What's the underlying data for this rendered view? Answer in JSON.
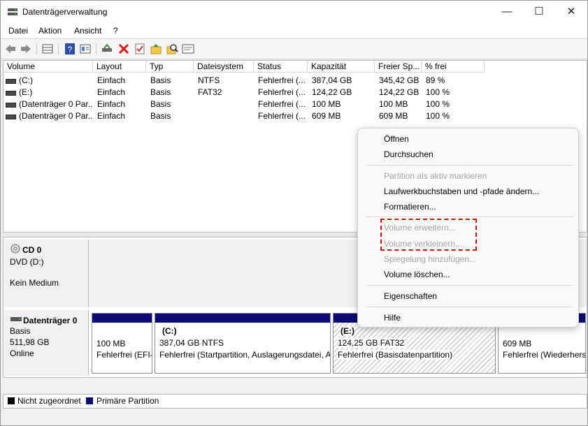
{
  "window": {
    "title": "Datenträgerverwaltung",
    "min": "—",
    "max": "☐",
    "close": "✕"
  },
  "menu": [
    "Datei",
    "Aktion",
    "Ansicht",
    "?"
  ],
  "toolbar_icons": [
    "back-icon",
    "forward-icon",
    "list-view-icon",
    "help-icon",
    "properties-icon",
    "connect-icon",
    "delete-icon",
    "check-icon",
    "folder-up-icon",
    "search-icon",
    "console-icon"
  ],
  "volume_table": {
    "columns": [
      "Volume",
      "Layout",
      "Typ",
      "Dateisystem",
      "Status",
      "Kapazität",
      "Freier Sp...",
      "% frei"
    ],
    "rows": [
      [
        "(C:)",
        "Einfach",
        "Basis",
        "NTFS",
        "Fehlerfrei (...",
        "387,04 GB",
        "345,42 GB",
        "89 %"
      ],
      [
        "(E:)",
        "Einfach",
        "Basis",
        "FAT32",
        "Fehlerfrei (...",
        "124,22 GB",
        "124,22 GB",
        "100 %"
      ],
      [
        "(Datenträger 0 Par...",
        "Einfach",
        "Basis",
        "",
        "Fehlerfrei (...",
        "100 MB",
        "100 MB",
        "100 %"
      ],
      [
        "(Datenträger 0 Par...",
        "Einfach",
        "Basis",
        "",
        "Fehlerfrei (...",
        "609 MB",
        "609 MB",
        "100 %"
      ]
    ]
  },
  "cd": {
    "name": "CD 0",
    "drive": "DVD (D:)",
    "media": "Kein Medium"
  },
  "disk0": {
    "name": "Datenträger 0",
    "type": "Basis",
    "size": "511,98 GB",
    "state": "Online",
    "partitions": [
      {
        "label": "",
        "size": "100 MB",
        "status": "Fehlerfrei (EFI-"
      },
      {
        "label": "(C:)",
        "size": "387,04 GB NTFS",
        "status": "Fehlerfrei (Startpartition, Auslagerungsdatei, A"
      },
      {
        "label": "(E:)",
        "size": "124,25 GB FAT32",
        "status": "Fehlerfrei (Basisdatenpartition)"
      },
      {
        "label": "",
        "size": "609 MB",
        "status": "Fehlerfrei (Wiederhers"
      }
    ]
  },
  "legend": [
    {
      "label": "Nicht zugeordnet",
      "color": "#000000"
    },
    {
      "label": "Primäre Partition",
      "color": "#0a0a78"
    }
  ],
  "context_menu": {
    "items": [
      {
        "label": "Öffnen",
        "enabled": true
      },
      {
        "label": "Durchsuchen",
        "enabled": true
      },
      {
        "label": "Partition als aktiv markieren",
        "enabled": false
      },
      {
        "label": "Laufwerkbuchstaben und -pfade ändern...",
        "enabled": true
      },
      {
        "label": "Formatieren...",
        "enabled": true
      },
      {
        "label": "Volume erweitern...",
        "enabled": false
      },
      {
        "label": "Volume verkleinern...",
        "enabled": false
      },
      {
        "label": "Spiegelung hinzufügen...",
        "enabled": false
      },
      {
        "label": "Volume löschen...",
        "enabled": true
      },
      {
        "label": "Eigenschaften",
        "enabled": true
      },
      {
        "label": "Hilfe",
        "enabled": true
      }
    ]
  },
  "highlight_color": "#e00000"
}
